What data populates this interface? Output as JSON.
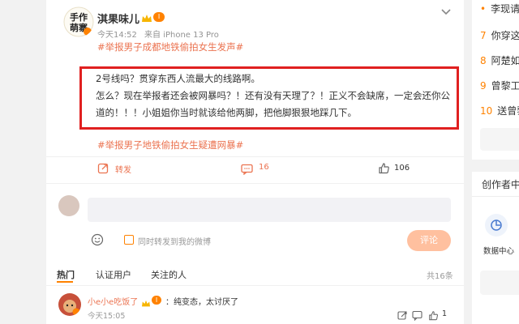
{
  "post": {
    "username": "淇果味儿",
    "level_badge": "Ⅰ",
    "time": "今天14:52",
    "source": "来自 iPhone 13 Pro",
    "hashtag_top": "#举报男子成都地铁偷拍女生发声#",
    "content_lines": [
      "2号线吗？贯穿东西人流最大的线路啊。",
      "怎么？现在举报者还会被网暴吗？！还有没有天理了？！正义不会缺席，一定会还你公",
      "道的！！！小姐姐你当时就该给他两脚，把他脚狠狠地踩几下。"
    ],
    "hashtag_bottom": "#举报男子地铁偷拍女生疑遭网暴#"
  },
  "actions": {
    "repost_label": "转发",
    "comment_count": "16",
    "like_count": "106"
  },
  "comment_box": {
    "placeholder": "",
    "forward_label": "同时转发到我的微博",
    "submit_label": "评论"
  },
  "tabs": {
    "hot": "热门",
    "verified": "认证用户",
    "following": "关注的人",
    "total": "共16条"
  },
  "comment": {
    "username": "小e小e吃饭了",
    "text": "：纯变态，太讨厌了",
    "time": "今天15:05",
    "like_count": "1"
  },
  "sidebar": {
    "rank_items": [
      {
        "num": "",
        "text": "李现请"
      },
      {
        "num": "7",
        "text": "你穿这"
      },
      {
        "num": "8",
        "text": "阿楚如"
      },
      {
        "num": "9",
        "text": "曾黎工"
      },
      {
        "num": "10",
        "text": "送曾黎"
      }
    ],
    "creator_title": "创作者中",
    "data_center_label": "数据中心"
  },
  "colors": {
    "accent": "#ff8200",
    "link": "#eb7350",
    "highlight_box": "#e02020"
  }
}
